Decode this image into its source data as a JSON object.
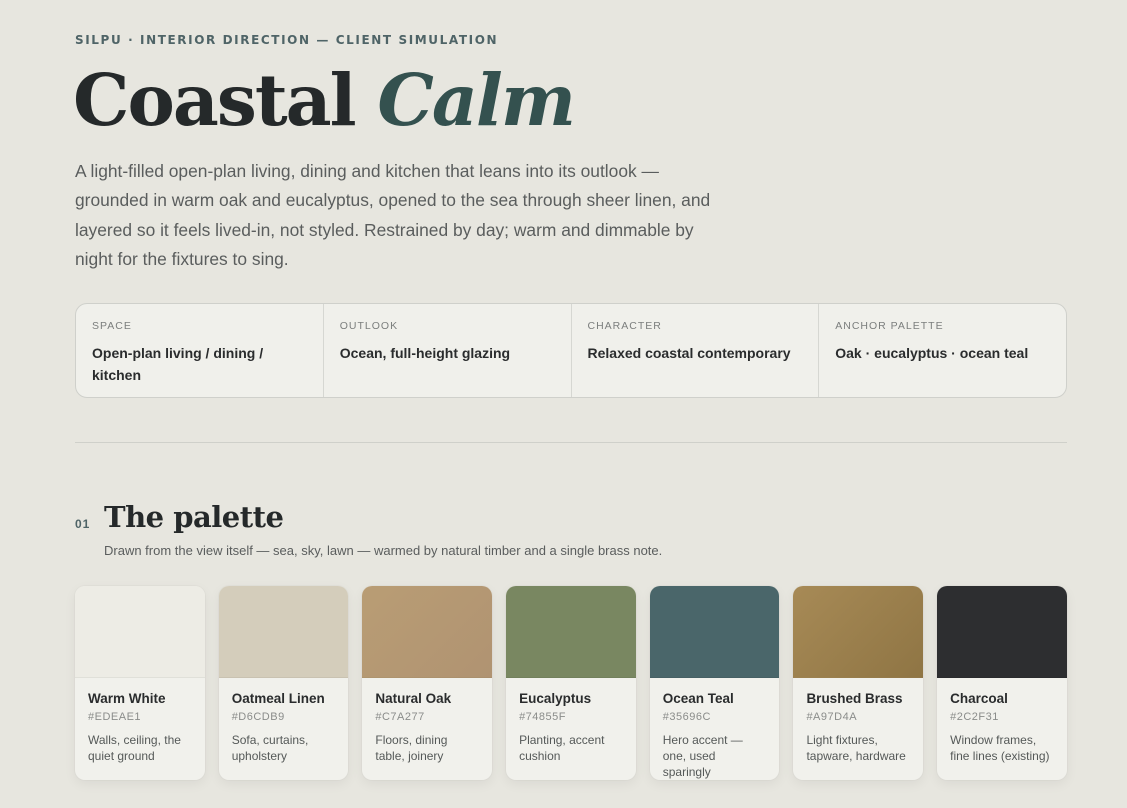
{
  "header": {
    "eyebrow": "SILPU · INTERIOR DIRECTION — CLIENT SIMULATION",
    "title_main": "Coastal",
    "title_accent": "Calm",
    "intro": "A light-filled open-plan living, dining and kitchen that leans into its outlook — grounded in warm oak and eucalyptus, opened to the sea through sheer linen, and layered so it feels lived-in, not styled. Restrained by day; warm and dimmable by night for the fixtures to sing."
  },
  "facts": [
    {
      "label": "SPACE",
      "value": "Open-plan living / dining / kitchen"
    },
    {
      "label": "OUTLOOK",
      "value": "Ocean, full-height glazing"
    },
    {
      "label": "CHARACTER",
      "value": "Relaxed coastal contemporary"
    },
    {
      "label": "ANCHOR PALETTE",
      "value": "Oak · eucalyptus · ocean teal"
    }
  ],
  "section": {
    "number": "01",
    "title": "The palette",
    "subtitle": "Drawn from the view itself — sea, sky, lawn — warmed by natural timber and a single brass note."
  },
  "palette": [
    {
      "name": "Warm White",
      "hex": "#EDEAE1",
      "color": "#edece5",
      "use": "Walls, ceiling, the quiet ground"
    },
    {
      "name": "Oatmeal Linen",
      "hex": "#D6CDB9",
      "color": "#d4cdbb",
      "use": "Sofa, curtains, upholstery"
    },
    {
      "name": "Natural Oak",
      "hex": "#C7A277",
      "color": "#b99d74",
      "use": "Floors, dining table, joinery"
    },
    {
      "name": "Eucalyptus",
      "hex": "#74855F",
      "color": "#798761",
      "use": "Planting, accent cushion"
    },
    {
      "name": "Ocean Teal",
      "hex": "#35696C",
      "color": "#4a666a",
      "use": "Hero accent — one, used sparingly"
    },
    {
      "name": "Brushed Brass",
      "hex": "#A97D4A",
      "color": "#a78a56",
      "use": "Light fixtures, tapware, hardware"
    },
    {
      "name": "Charcoal",
      "hex": "#2C2F31",
      "color": "#2d2e30",
      "use": "Window frames, fine lines (existing)"
    }
  ]
}
